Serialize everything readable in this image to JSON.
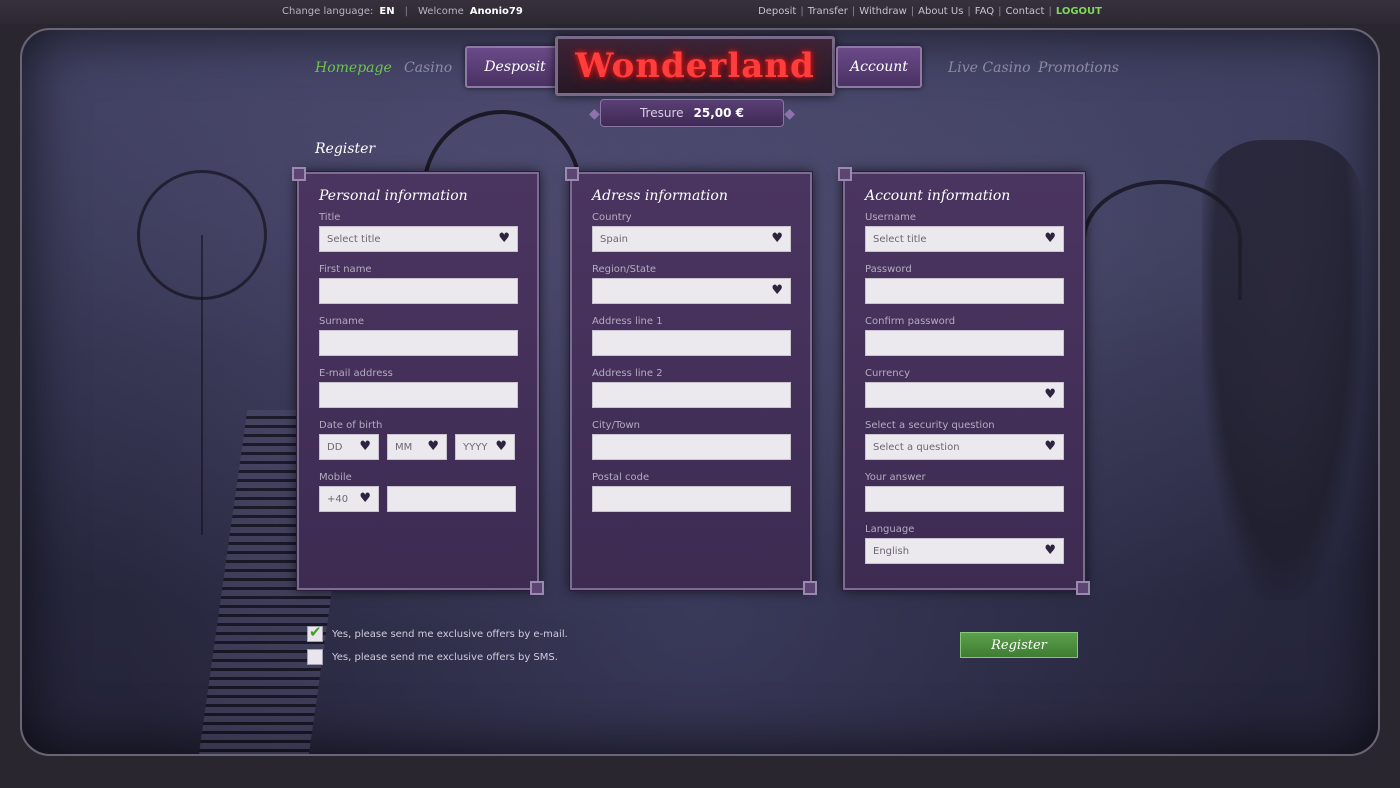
{
  "topbar": {
    "change_language_label": "Change language:",
    "language": "EN",
    "welcome_label": "Welcome",
    "username": "Anonio79",
    "links": [
      "Deposit",
      "Transfer",
      "Withdraw",
      "About Us",
      "FAQ",
      "Contact"
    ],
    "logout": "LOGOUT"
  },
  "nav": {
    "homepage": "Homepage",
    "casino": "Casino",
    "deposit": "Desposit",
    "logo": "Wonderland",
    "account": "Account",
    "live_casino": "Live Casino",
    "promotions": "Promotions"
  },
  "treasure": {
    "label": "Tresure",
    "value": "25,00 €"
  },
  "page_title": "Register",
  "personal": {
    "heading": "Personal information",
    "title_label": "Title",
    "title_placeholder": "Select title",
    "first_name_label": "First name",
    "surname_label": "Surname",
    "email_label": "E-mail address",
    "dob_label": "Date of birth",
    "dd": "DD",
    "mm": "MM",
    "yyyy": "YYYY",
    "mobile_label": "Mobile",
    "mobile_prefix": "+40"
  },
  "address": {
    "heading": "Adress information",
    "country_label": "Country",
    "country_value": "Spain",
    "region_label": "Region/State",
    "line1_label": "Address line 1",
    "line2_label": "Address line 2",
    "city_label": "City/Town",
    "postal_label": "Postal code"
  },
  "account": {
    "heading": "Account information",
    "username_label": "Username",
    "username_placeholder": "Select title",
    "password_label": "Password",
    "confirm_label": "Confirm password",
    "currency_label": "Currency",
    "security_label": "Select a security question",
    "security_placeholder": "Select a question",
    "answer_label": "Your answer",
    "language_label": "Language",
    "language_value": "English"
  },
  "offers": {
    "email": "Yes, please send me exclusive offers by e-mail.",
    "email_checked": true,
    "sms": "Yes, please send me exclusive offers by SMS.",
    "sms_checked": false
  },
  "register_button": "Register",
  "icons": {
    "select": "heart-chevron-icon",
    "check": "checkmark-icon"
  },
  "colors": {
    "accent_green": "#7ed957",
    "logo_red": "#ff3d3d",
    "panel_purple": "#4a3560"
  }
}
